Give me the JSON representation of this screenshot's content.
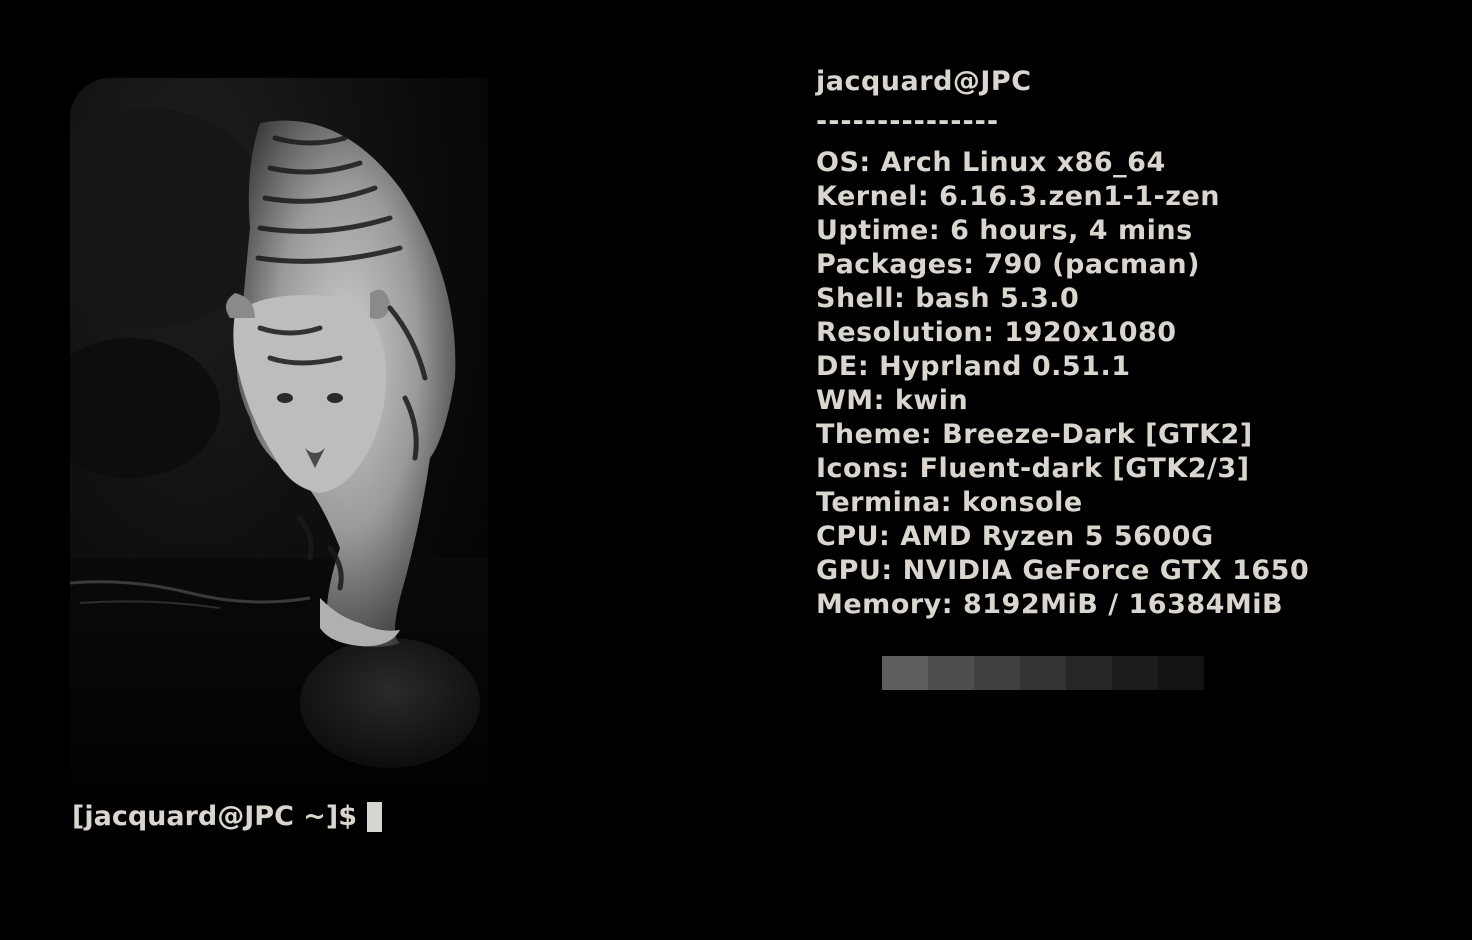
{
  "terminal": {
    "user_host": "jacquard@JPC",
    "separator": "---------------",
    "info": [
      {
        "key": "OS",
        "value": "Arch Linux x86_64"
      },
      {
        "key": "Kernel",
        "value": "6.16.3.zen1-1-zen"
      },
      {
        "key": "Uptime",
        "value": "6 hours, 4 mins"
      },
      {
        "key": "Packages",
        "value": "790 (pacman)"
      },
      {
        "key": "Shell",
        "value": "bash 5.3.0"
      },
      {
        "key": "Resolution",
        "value": "1920x1080"
      },
      {
        "key": "DE",
        "value": "Hyprland 0.51.1"
      },
      {
        "key": "WM",
        "value": "kwin"
      },
      {
        "key": "Theme",
        "value": "Breeze-Dark [GTK2]"
      },
      {
        "key": "Icons",
        "value": "Fluent-dark [GTK2/3]"
      },
      {
        "key": "Termina",
        "value": "konsole"
      },
      {
        "key": "CPU",
        "value": "AMD Ryzen 5 5600G"
      },
      {
        "key": "GPU",
        "value": "NVIDIA GeForce GTX 1650"
      },
      {
        "key": "Memory",
        "value": "8192MiB / 16384MiB"
      }
    ],
    "palette": [
      "#5e5e5e",
      "#4e4e4e",
      "#404040",
      "#333333",
      "#272727",
      "#1c1c1c",
      "#141414"
    ],
    "prompt": "[jacquard@JPC ~]$",
    "image": "tiger-image"
  }
}
